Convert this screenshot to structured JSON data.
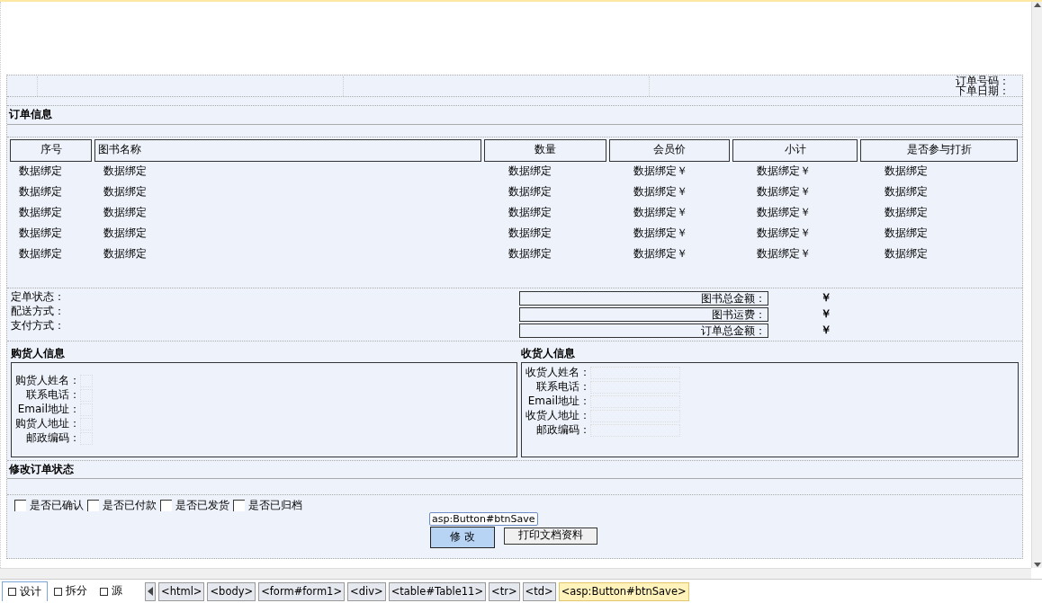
{
  "header": {
    "order_no_label": "订单号码：",
    "order_date_label": "下单日期："
  },
  "order_section": {
    "title": "订单信息"
  },
  "table": {
    "columns": [
      "序号",
      "图书名称",
      "数量",
      "会员价",
      "小计",
      "是否参与打折"
    ],
    "rows": [
      [
        "数据绑定",
        "数据绑定",
        "数据绑定",
        "数据绑定￥",
        "数据绑定￥",
        "数据绑定"
      ],
      [
        "数据绑定",
        "数据绑定",
        "数据绑定",
        "数据绑定￥",
        "数据绑定￥",
        "数据绑定"
      ],
      [
        "数据绑定",
        "数据绑定",
        "数据绑定",
        "数据绑定￥",
        "数据绑定￥",
        "数据绑定"
      ],
      [
        "数据绑定",
        "数据绑定",
        "数据绑定",
        "数据绑定￥",
        "数据绑定￥",
        "数据绑定"
      ],
      [
        "数据绑定",
        "数据绑定",
        "数据绑定",
        "数据绑定￥",
        "数据绑定￥",
        "数据绑定"
      ]
    ]
  },
  "status_labels": [
    "定单状态：",
    "配送方式：",
    "支付方式："
  ],
  "totals": [
    {
      "label": "图书总金额：",
      "currency": "￥"
    },
    {
      "label": "图书运费：",
      "currency": "￥"
    },
    {
      "label": "订单总金额：",
      "currency": "￥"
    }
  ],
  "buyer": {
    "title": "购货人信息",
    "fields": [
      "购货人姓名：",
      "联系电话：",
      "Email地址：",
      "购货人地址：",
      "邮政编码："
    ]
  },
  "receiver": {
    "title": "收货人信息",
    "fields": [
      "收货人姓名：",
      "联系电话：",
      "Email地址：",
      "收货人地址：",
      "邮政编码："
    ]
  },
  "modify_section": {
    "title": "修改订单状态",
    "checkboxes": [
      {
        "label": "是否已确认",
        "checked": false
      },
      {
        "label": "是否已付款",
        "checked": false
      },
      {
        "label": "是否已发货",
        "checked": false
      },
      {
        "label": "是否已归档",
        "checked": false
      }
    ]
  },
  "control_tag": "asp:Button#btnSave",
  "buttons": [
    {
      "label": "修 改",
      "selected": true
    },
    {
      "label": "打印文档资料",
      "selected": false
    }
  ],
  "view_tabs": [
    {
      "label": "设计",
      "selected": true
    },
    {
      "label": "拆分",
      "selected": false
    },
    {
      "label": "源",
      "selected": false
    }
  ],
  "breadcrumb": [
    {
      "label": "<html>",
      "selected": false
    },
    {
      "label": "<body>",
      "selected": false
    },
    {
      "label": "<form#form1>",
      "selected": false
    },
    {
      "label": "<div>",
      "selected": false
    },
    {
      "label": "<table#Table11>",
      "selected": false
    },
    {
      "label": "<tr>",
      "selected": false
    },
    {
      "label": "<td>",
      "selected": false
    },
    {
      "label": "<asp:Button#btnSave>",
      "selected": true
    }
  ]
}
